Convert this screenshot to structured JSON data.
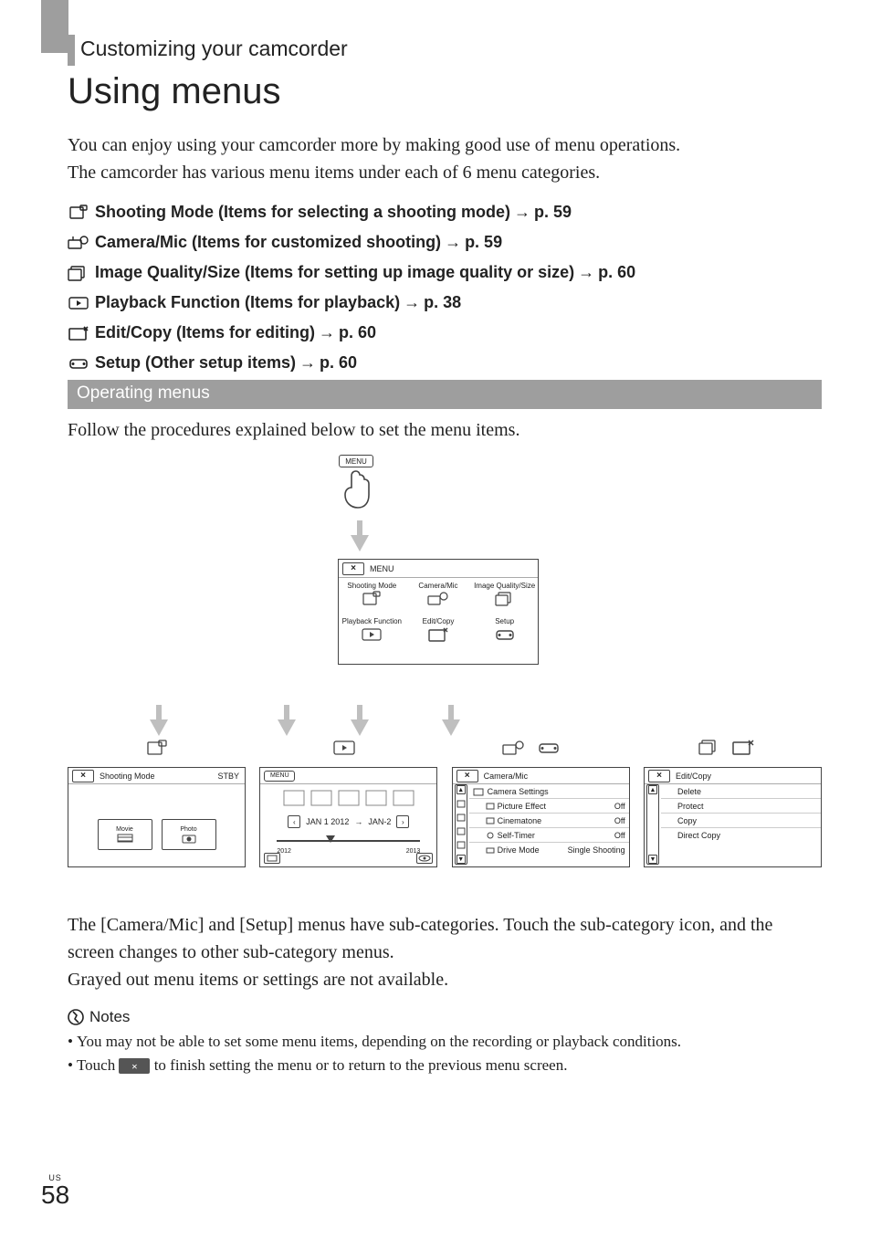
{
  "section": "Customizing your camcorder",
  "title": "Using menus",
  "intro_line1": "You can enjoy using your camcorder more by making good use of menu operations.",
  "intro_line2": "The camcorder has various menu items under each of 6 menu categories.",
  "arrow": "→",
  "menu_items": [
    {
      "label": "Shooting Mode (Items for selecting a shooting mode)",
      "page": "p. 59",
      "icon": "shooting-mode"
    },
    {
      "label": "Camera/Mic (Items for customized shooting)",
      "page": "p. 59",
      "icon": "camera-mic"
    },
    {
      "label": "Image Quality/Size (Items for setting up image quality or size)",
      "page": "p. 60",
      "icon": "image-quality"
    },
    {
      "label": "Playback Function (Items for playback)",
      "page": "p. 38",
      "icon": "playback"
    },
    {
      "label": "Edit/Copy (Items for editing)",
      "page": "p. 60",
      "icon": "edit-copy"
    },
    {
      "label": "Setup (Other setup items)",
      "page": "p. 60",
      "icon": "setup"
    }
  ],
  "operating_header": "Operating menus",
  "follow_text": "Follow the procedures explained below to set the menu items.",
  "diagram": {
    "menu_btn": "MENU",
    "top_panel": {
      "close": "×",
      "title": "MENU",
      "cells": [
        {
          "label": "Shooting Mode"
        },
        {
          "label": "Camera/Mic"
        },
        {
          "label": "Image Quality/Size"
        },
        {
          "label": "Playback Function"
        },
        {
          "label": "Edit/Copy"
        },
        {
          "label": "Setup"
        }
      ]
    },
    "cards": {
      "shooting_mode": {
        "close": "×",
        "title": "Shooting Mode",
        "status": "STBY",
        "btn_movie": "Movie",
        "btn_photo": "Photo"
      },
      "playback": {
        "menu": "MENU",
        "date_left": "JAN 1 2012",
        "arrow": "→",
        "date_right": "JAN-2",
        "year_from": "2012",
        "year_to": "2013"
      },
      "camera_mic": {
        "close": "×",
        "title": "Camera/Mic",
        "header2": "Camera Settings",
        "rows": [
          {
            "label": "Picture Effect",
            "value": "Off"
          },
          {
            "label": "Cinematone",
            "value": "Off"
          },
          {
            "label": "Self-Timer",
            "value": "Off"
          },
          {
            "label": "Drive Mode",
            "value": "Single Shooting"
          }
        ]
      },
      "edit_copy": {
        "close": "×",
        "title": "Edit/Copy",
        "rows": [
          {
            "label": "Delete"
          },
          {
            "label": "Protect"
          },
          {
            "label": "Copy"
          },
          {
            "label": "Direct Copy"
          }
        ]
      }
    }
  },
  "para1": "The [Camera/Mic] and [Setup] menus have sub-categories. Touch the sub-category icon, and the screen changes to other sub-category menus.",
  "para2": "Grayed out menu items or settings are not available.",
  "notes_label": "Notes",
  "notes": {
    "n1": "You may not be able to set some menu items, depending on the recording or playback conditions.",
    "n2a": "Touch ",
    "n2_close": "×",
    "n2b": " to finish setting the menu or to return to the previous menu screen."
  },
  "page_locale": "US",
  "page_number": "58"
}
